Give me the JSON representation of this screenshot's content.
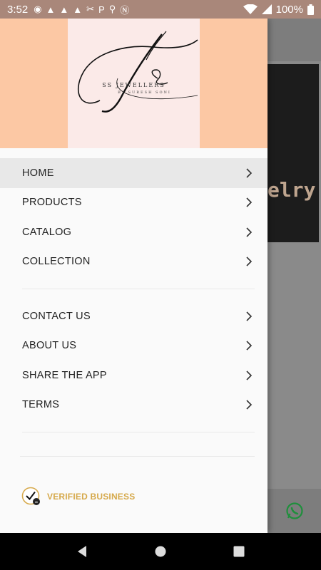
{
  "status_bar": {
    "time": "3:52",
    "battery": "100%",
    "notification_icons": [
      "message-icon",
      "warning-icon",
      "warning-icon",
      "warning-icon",
      "scissors-icon",
      "parking-icon",
      "location-icon",
      "bitcoin-icon"
    ]
  },
  "header": {
    "logo_name": "SS JEWELLERS",
    "logo_sub": "BY SURESH SONI"
  },
  "menu": {
    "primary": [
      {
        "label": "HOME",
        "active": true
      },
      {
        "label": "PRODUCTS",
        "active": false
      },
      {
        "label": "CATALOG",
        "active": false
      },
      {
        "label": "COLLECTION",
        "active": false
      }
    ],
    "secondary": [
      {
        "label": "CONTACT US"
      },
      {
        "label": "ABOUT US"
      },
      {
        "label": "SHARE THE APP"
      },
      {
        "label": "TERMS"
      }
    ]
  },
  "verified": {
    "label": "VERIFIED BUSINESS"
  },
  "background": {
    "banner_text": "elry"
  },
  "colors": {
    "header_bg": "#fcc8a4",
    "logo_bg": "#fbeae8",
    "verified": "#d6a94b",
    "whatsapp": "#25a244"
  }
}
